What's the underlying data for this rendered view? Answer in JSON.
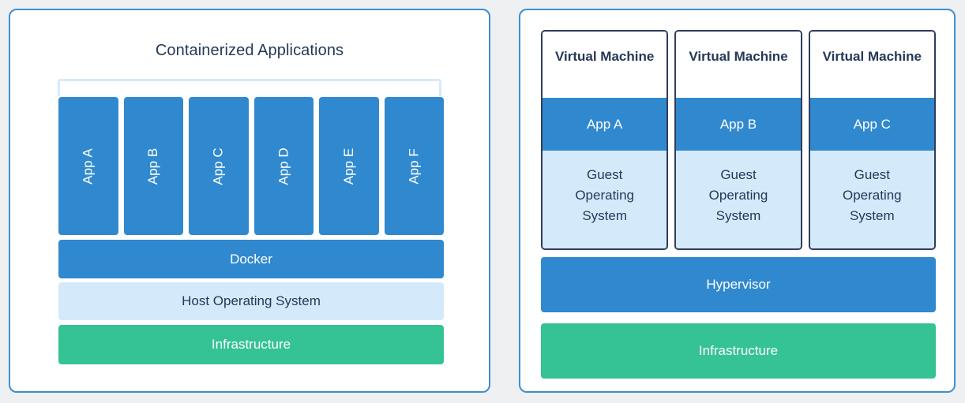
{
  "theme": {
    "background": "#eff0f2",
    "card_border": "#3f8fd2",
    "blue": "#3089ce",
    "light_blue": "#d4eafa",
    "bracket_blue": "#d7eafb",
    "green": "#35c295",
    "navy_text": "#253858",
    "vm_border": "#2f3d5c",
    "white": "#ffffff"
  },
  "containers_panel": {
    "title": "Containerized Applications",
    "apps": [
      {
        "label": "App A"
      },
      {
        "label": "App B"
      },
      {
        "label": "App C"
      },
      {
        "label": "App D"
      },
      {
        "label": "App E"
      },
      {
        "label": "App F"
      }
    ],
    "layers": [
      {
        "label": "Docker",
        "style": "blue"
      },
      {
        "label": "Host Operating System",
        "style": "light-blue"
      },
      {
        "label": "Infrastructure",
        "style": "green"
      }
    ]
  },
  "vm_panel": {
    "machines": [
      {
        "title": "Virtual Machine",
        "app": "App A",
        "guest_line1": "Guest",
        "guest_line2": "Operating",
        "guest_line3": "System"
      },
      {
        "title": "Virtual Machine",
        "app": "App B",
        "guest_line1": "Guest",
        "guest_line2": "Operating",
        "guest_line3": "System"
      },
      {
        "title": "Virtual Machine",
        "app": "App C",
        "guest_line1": "Guest",
        "guest_line2": "Operating",
        "guest_line3": "System"
      }
    ],
    "layers": [
      {
        "label": "Hypervisor",
        "style": "blue"
      },
      {
        "label": "Infrastructure",
        "style": "green"
      }
    ]
  }
}
